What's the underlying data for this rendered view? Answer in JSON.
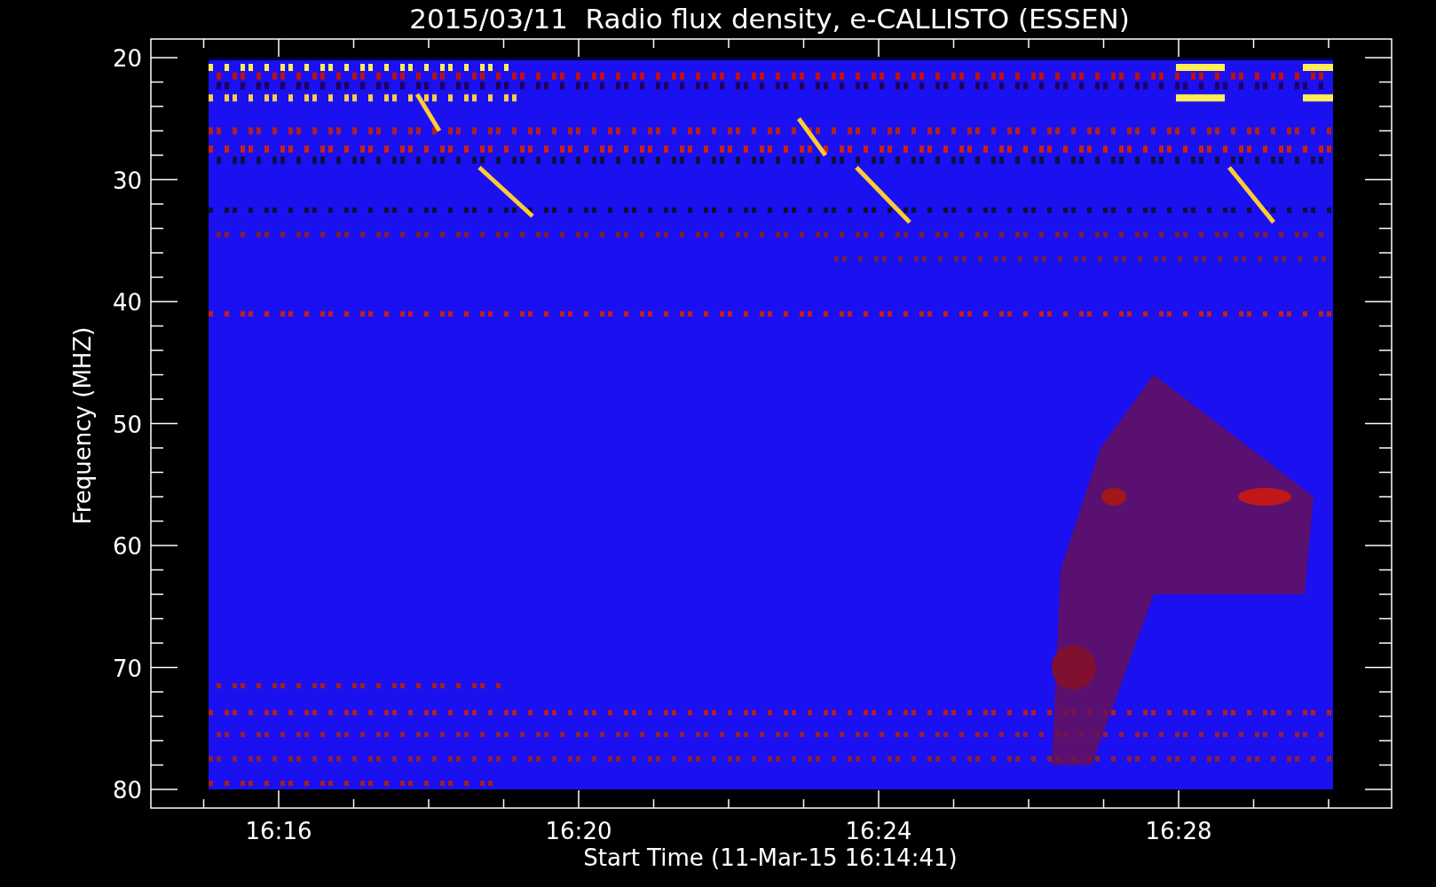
{
  "title": "2015/03/11  Radio flux density, e-CALLISTO (ESSEN)",
  "plot": {
    "ylabel": "Frequency (MHZ)",
    "xlabel": "Start Time (11-Mar-15 16:14:41)",
    "yticks": [
      "20",
      "30",
      "40",
      "50",
      "60",
      "70",
      "80"
    ],
    "xticks": [
      "16:16",
      "16:20",
      "16:24",
      "16:28"
    ]
  }
}
